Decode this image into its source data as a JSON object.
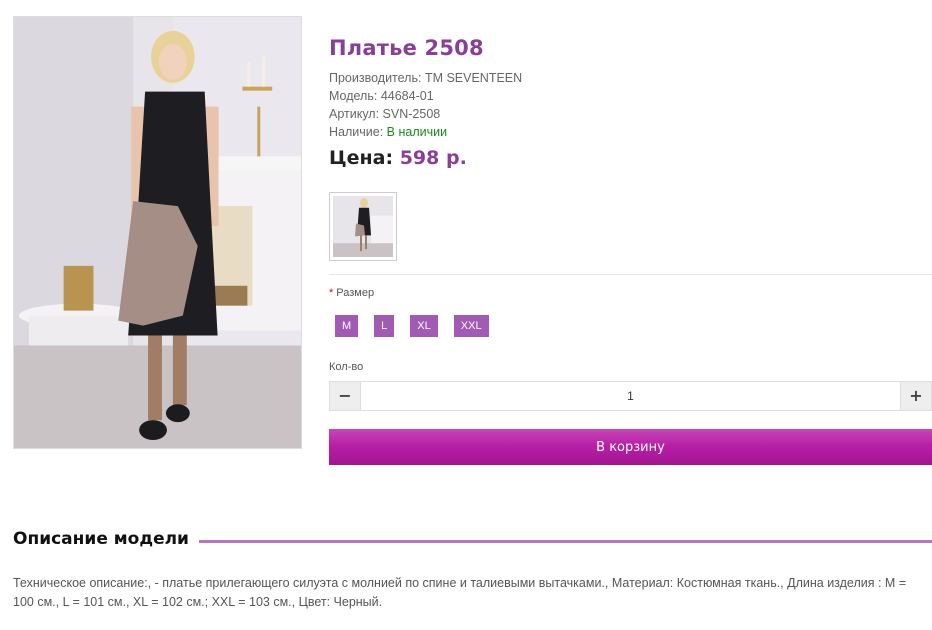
{
  "product": {
    "title": "Платье 2508",
    "manufacturer": {
      "label": "Производитель: ",
      "value": "TM SEVENTEEN"
    },
    "model": {
      "label": "Модель: ",
      "value": "44684-01"
    },
    "sku": {
      "label": "Артикул: ",
      "value": "SVN-2508"
    },
    "availability": {
      "label": "Наличие: ",
      "value": "В наличии",
      "color": "#1a8a1a"
    },
    "price": {
      "label": "Цена: ",
      "value": "598 р."
    }
  },
  "options": {
    "size_label": "Размер",
    "required_mark": "*",
    "sizes": [
      "M",
      "L",
      "XL",
      "XXL"
    ]
  },
  "quantity": {
    "label": "Кол-во",
    "value": "1",
    "minus": "−",
    "plus": "+"
  },
  "cart_button": "В корзину",
  "description": {
    "title": "Описание модели",
    "text": "Техническое описание:, - платье прилегающего силуэта с молнией по спине и талиевыми вытачками., Материал: Костюмная ткань., Длина изделия : M = 100 см., L = 101 см., XL = 102 см.; XXL = 103 см., Цвет: Черный."
  },
  "colors": {
    "accent": "#8a3f97",
    "size_button": "#a15bb5",
    "cart_button": "#b91fa8",
    "divider_line": "#b974c4"
  }
}
